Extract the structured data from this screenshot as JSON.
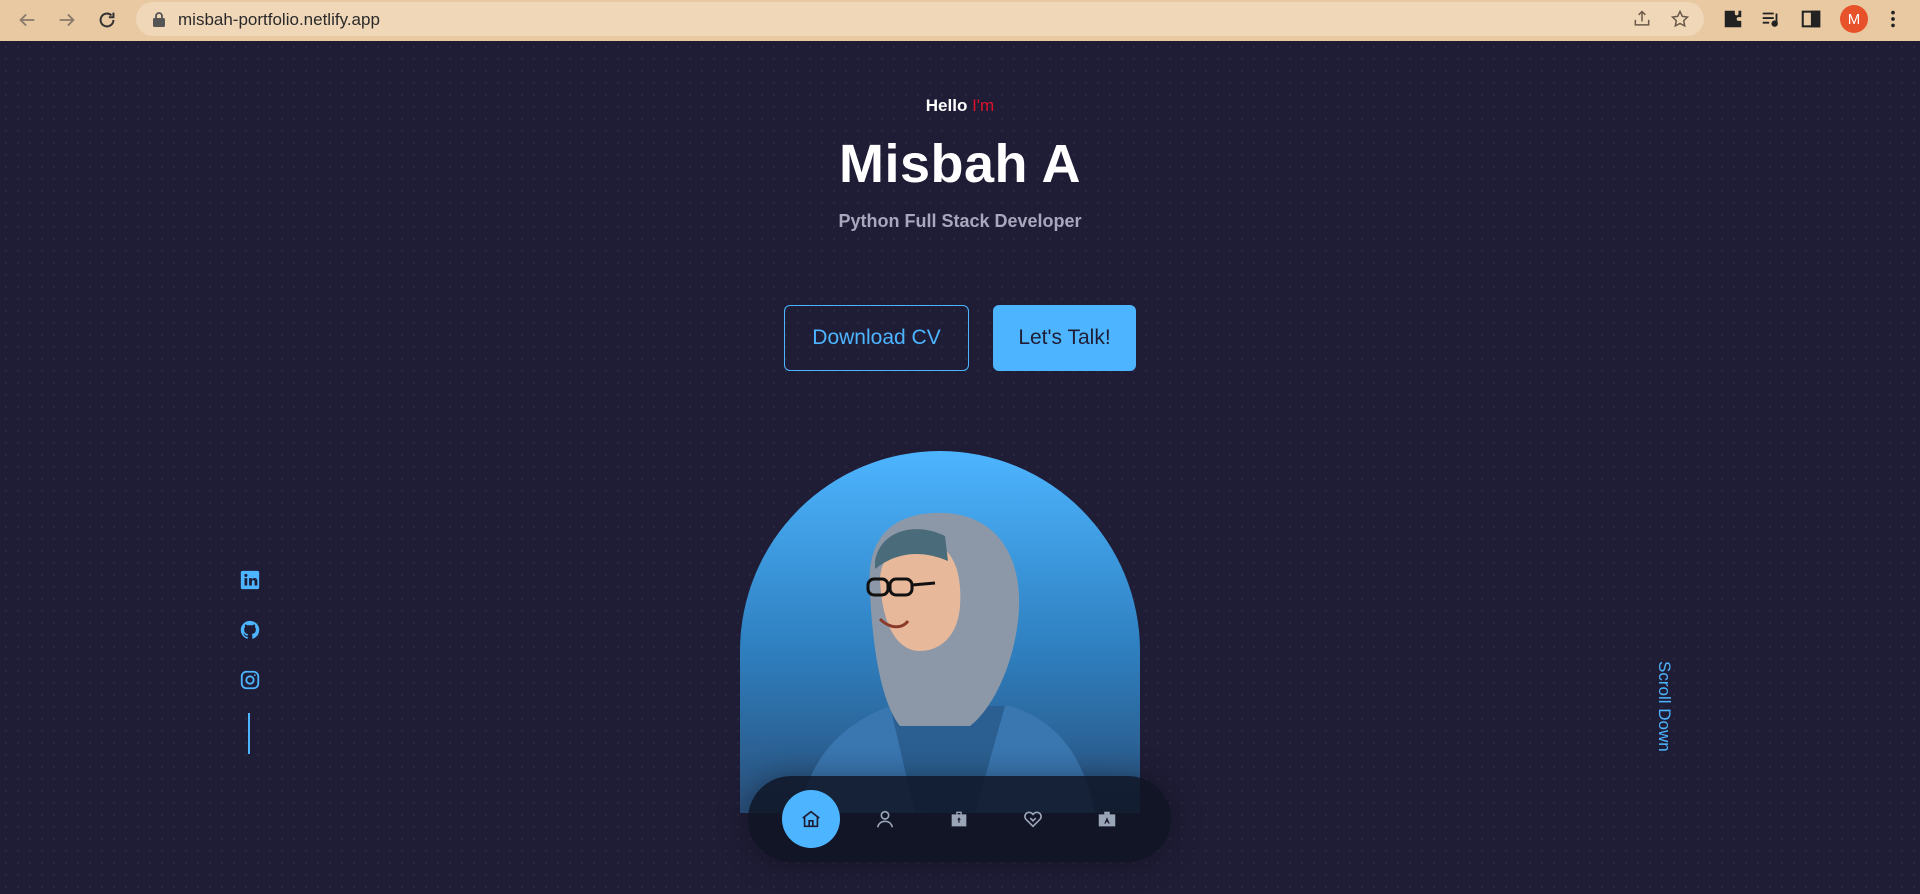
{
  "browser": {
    "url": "misbah-portfolio.netlify.app",
    "avatar_letter": "M",
    "avatar_color": "#e8522a"
  },
  "hero": {
    "hello": "Hello",
    "im": "I'm",
    "name": "Misbah A",
    "role": "Python Full Stack Developer",
    "download_cv": "Download CV",
    "lets_talk": "Let's Talk!",
    "scroll_down": "Scroll Down"
  },
  "socials": [
    "linkedin-icon",
    "github-icon",
    "instagram-icon"
  ],
  "bottom_nav": {
    "items": [
      "home-icon",
      "user-icon",
      "briefcase-icon",
      "handshake-icon",
      "contact-icon"
    ],
    "active": "home-icon"
  },
  "colors": {
    "background": "#1f1d36",
    "accent": "#4db5ff",
    "highlight": "#e0102c",
    "chrome": "#e8c9a2"
  }
}
